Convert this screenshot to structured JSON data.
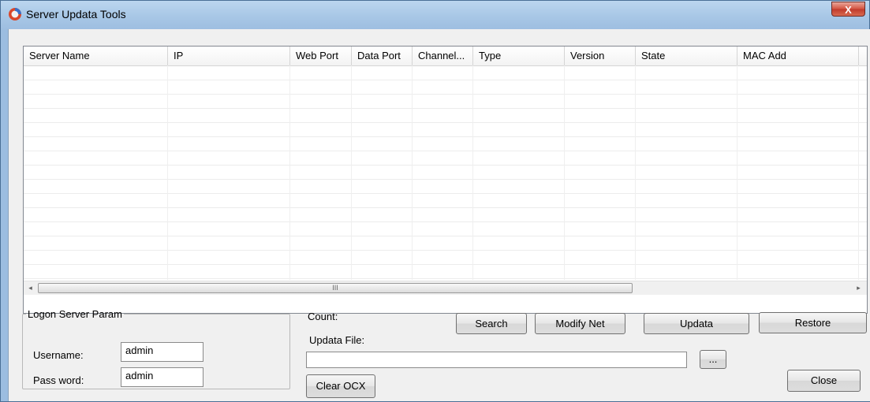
{
  "window": {
    "title": "Server Updata Tools",
    "close_glyph": "X"
  },
  "list": {
    "columns": [
      "Server Name",
      "IP",
      "Web Port",
      "Data Port",
      "Channel...",
      "Type",
      "Version",
      "State",
      "MAC Add"
    ],
    "rows": []
  },
  "scrollbar": {
    "left_arrow": "◂",
    "right_arrow": "▸",
    "thumb_grip": "III"
  },
  "logon": {
    "legend": "Logon Server Param",
    "username_label": "Username:",
    "username_value": "admin",
    "password_label": "Pass word:",
    "password_value": "admin"
  },
  "update": {
    "count_label": "Count:",
    "file_label": "Updata File:",
    "file_value": "",
    "browse_label": "...",
    "clear_ocx_label": "Clear OCX"
  },
  "buttons": {
    "search": "Search",
    "modify_net": "Modify Net",
    "updata": "Updata",
    "restore": "Restore",
    "close": "Close"
  }
}
